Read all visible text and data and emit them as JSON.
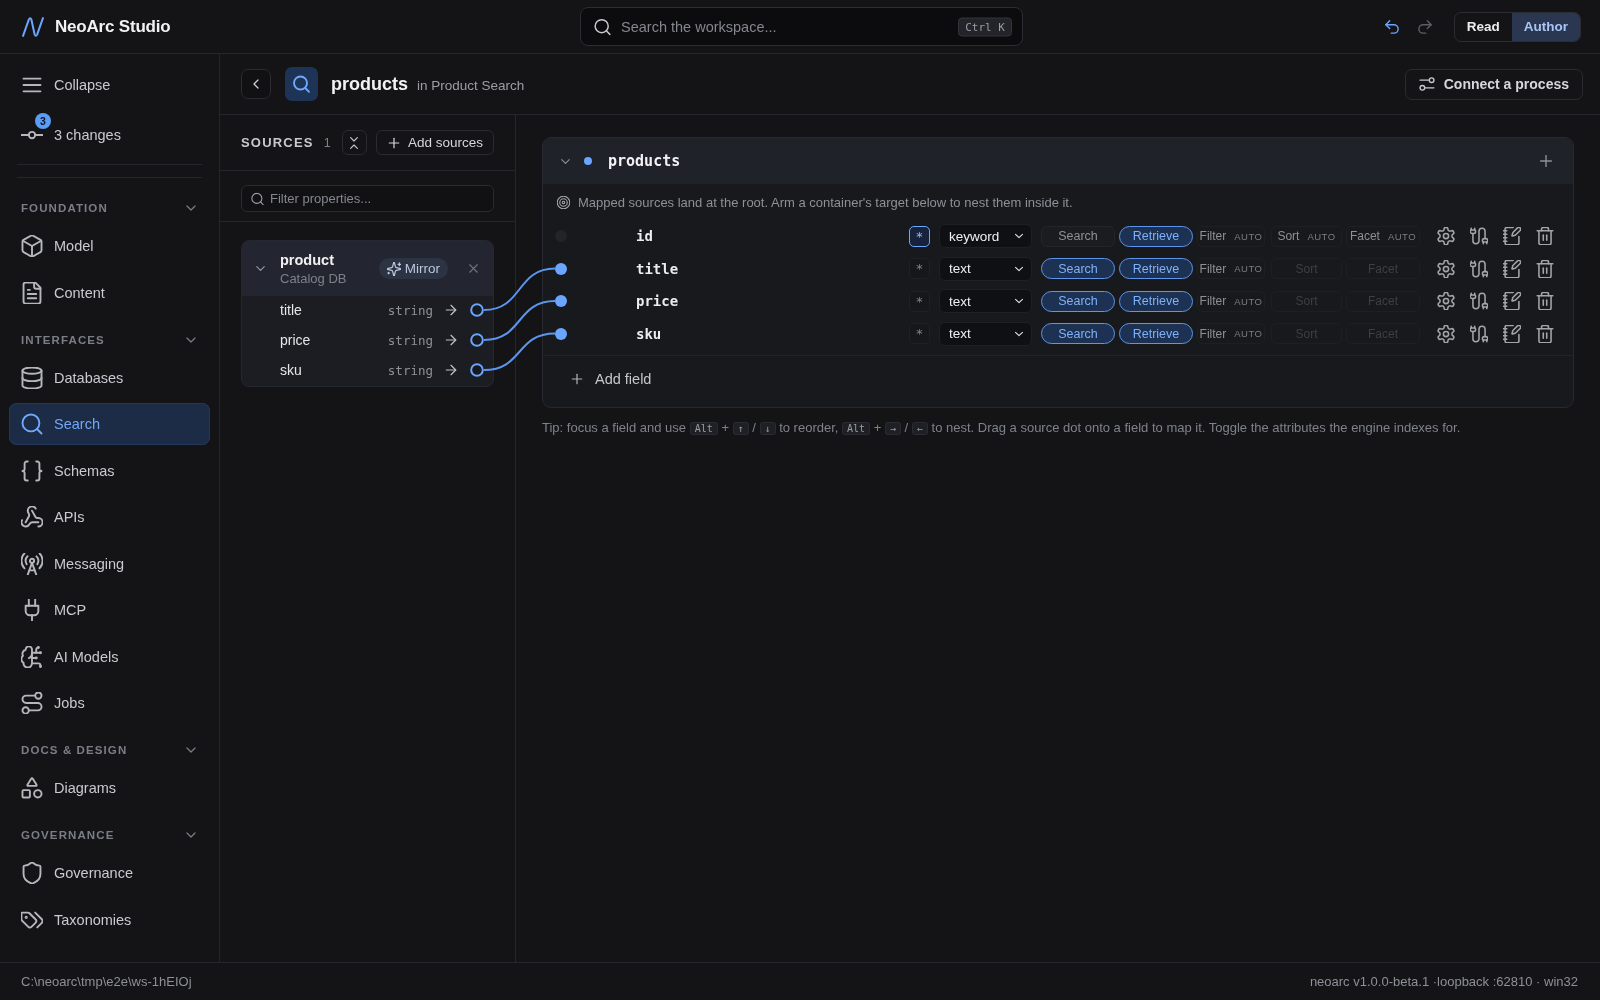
{
  "app": {
    "title": "NeoArc Studio"
  },
  "search": {
    "placeholder": "Search the workspace...",
    "shortcut": "Ctrl K"
  },
  "history": {
    "undo_disabled": false,
    "redo_disabled": true
  },
  "modes": [
    {
      "label": "Read",
      "selected": false
    },
    {
      "label": "Author",
      "selected": true
    }
  ],
  "sidebar": {
    "collapse": {
      "label": "Collapse"
    },
    "changes": {
      "label": "3 changes",
      "badge": "3"
    },
    "sections": [
      {
        "title": "FOUNDATION",
        "expanded": true,
        "items": [
          {
            "label": "Model",
            "selected": false
          },
          {
            "label": "Content",
            "selected": false
          }
        ]
      },
      {
        "title": "INTERFACES",
        "expanded": true,
        "items": [
          {
            "label": "Databases",
            "selected": false
          },
          {
            "label": "Search",
            "selected": true
          },
          {
            "label": "Schemas",
            "selected": false
          },
          {
            "label": "APIs",
            "selected": false
          },
          {
            "label": "Messaging",
            "selected": false
          },
          {
            "label": "MCP",
            "selected": false
          },
          {
            "label": "AI Models",
            "selected": false
          },
          {
            "label": "Jobs",
            "selected": false
          }
        ]
      },
      {
        "title": "DOCS & DESIGN",
        "expanded": true,
        "items": [
          {
            "label": "Diagrams",
            "selected": false
          }
        ]
      },
      {
        "title": "GOVERNANCE",
        "expanded": true,
        "items": [
          {
            "label": "Governance",
            "selected": false
          },
          {
            "label": "Taxonomies",
            "selected": false
          }
        ]
      }
    ]
  },
  "header": {
    "title": "products",
    "context": "in Product Search",
    "action": "Connect a process"
  },
  "sources": {
    "title": "SOURCES",
    "count": "1",
    "add": "Add sources",
    "filter_placeholder": "Filter properties...",
    "cards": [
      {
        "name": "product",
        "subtitle": "Catalog DB",
        "expanded": true,
        "badge": "Mirror",
        "fields": [
          {
            "name": "title",
            "type": "string",
            "mapped": true
          },
          {
            "name": "price",
            "type": "string",
            "mapped": true
          },
          {
            "name": "sku",
            "type": "string",
            "mapped": true
          }
        ]
      }
    ]
  },
  "schema": {
    "name": "products",
    "expanded": true,
    "hint": "Mapped sources land at the root. Arm a container's target below to nest them inside it.",
    "add": "Add field",
    "fields": [
      {
        "name": "id",
        "mapped": false,
        "primary": true,
        "primary_mark": "*",
        "type": "keyword",
        "toggles": [
          {
            "kind": "pill",
            "label": "Search",
            "on": false
          },
          {
            "kind": "pill",
            "label": "Retrieve",
            "on": true
          },
          {
            "kind": "auto",
            "label": "Filter",
            "badge": "AUTO",
            "on": true
          },
          {
            "kind": "auto",
            "label": "Sort",
            "badge": "AUTO",
            "on": true
          },
          {
            "kind": "auto",
            "label": "Facet",
            "badge": "AUTO",
            "on": true
          }
        ]
      },
      {
        "name": "title",
        "mapped": true,
        "primary": false,
        "primary_mark": "*",
        "type": "text",
        "toggles": [
          {
            "kind": "pill",
            "label": "Search",
            "on": true
          },
          {
            "kind": "pill",
            "label": "Retrieve",
            "on": true
          },
          {
            "kind": "auto",
            "label": "Filter",
            "badge": "AUTO",
            "on": true
          },
          {
            "kind": "auto",
            "label": "Sort",
            "on": false
          },
          {
            "kind": "auto",
            "label": "Facet",
            "on": false
          }
        ]
      },
      {
        "name": "price",
        "mapped": true,
        "primary": false,
        "primary_mark": "*",
        "type": "text",
        "toggles": [
          {
            "kind": "pill",
            "label": "Search",
            "on": true
          },
          {
            "kind": "pill",
            "label": "Retrieve",
            "on": true
          },
          {
            "kind": "auto",
            "label": "Filter",
            "badge": "AUTO",
            "on": true
          },
          {
            "kind": "auto",
            "label": "Sort",
            "on": false
          },
          {
            "kind": "auto",
            "label": "Facet",
            "on": false
          }
        ]
      },
      {
        "name": "sku",
        "mapped": true,
        "primary": false,
        "primary_mark": "*",
        "type": "text",
        "toggles": [
          {
            "kind": "pill",
            "label": "Search",
            "on": true
          },
          {
            "kind": "pill",
            "label": "Retrieve",
            "on": true
          },
          {
            "kind": "auto",
            "label": "Filter",
            "badge": "AUTO",
            "on": true
          },
          {
            "kind": "auto",
            "label": "Sort",
            "on": false
          },
          {
            "kind": "auto",
            "label": "Facet",
            "on": false
          }
        ]
      }
    ]
  },
  "tip": [
    {
      "kind": "text",
      "text": "Tip: focus a field and use"
    },
    {
      "kind": "key",
      "text": "Alt"
    },
    {
      "kind": "text",
      "text": "+"
    },
    {
      "kind": "key",
      "text": "↑"
    },
    {
      "kind": "text",
      "text": "/"
    },
    {
      "kind": "key",
      "text": "↓"
    },
    {
      "kind": "text",
      "text": "to reorder,"
    },
    {
      "kind": "key",
      "text": "Alt"
    },
    {
      "kind": "text",
      "text": "+"
    },
    {
      "kind": "key",
      "text": "→"
    },
    {
      "kind": "text",
      "text": "/"
    },
    {
      "kind": "key",
      "text": "←"
    },
    {
      "kind": "text",
      "text": "to nest. Drag a source dot onto a field to map it. Toggle the attributes the engine indexes for."
    }
  ],
  "status_bar": {
    "path": "C:\\neoarc\\tmp\\e2e\\ws-1hEIOj",
    "version": "neoarc v1.0.0-beta.1 ·loopback :62810 · win32"
  }
}
